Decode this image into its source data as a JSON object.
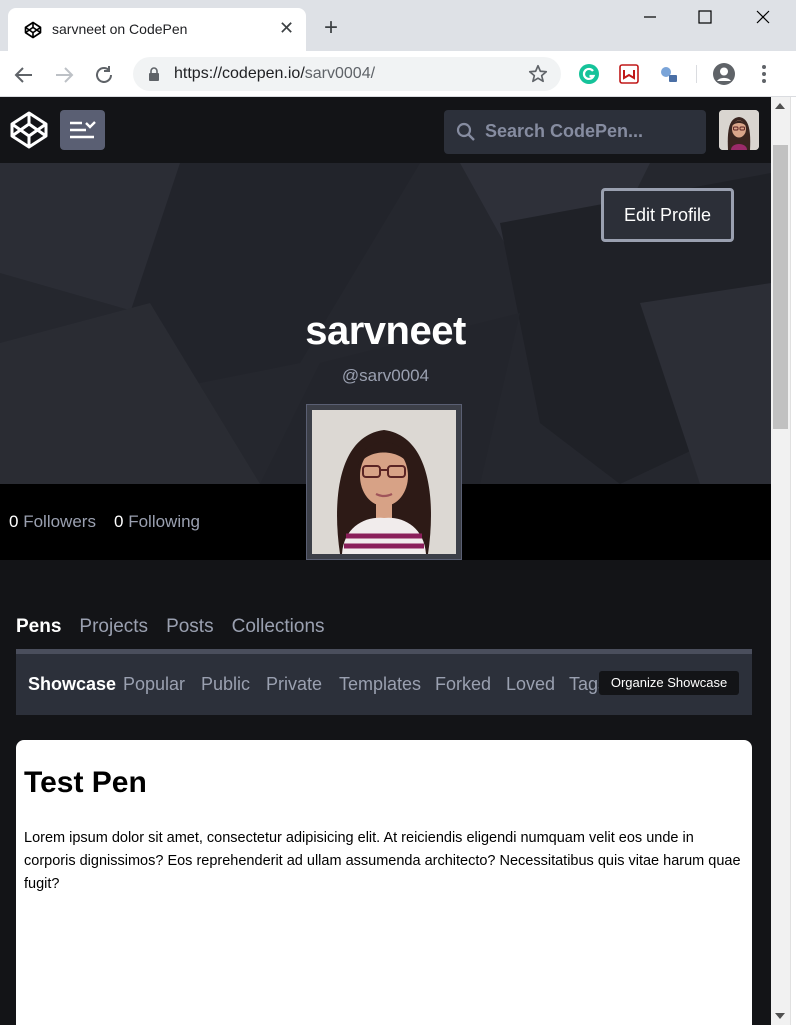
{
  "browser": {
    "tab_title": "sarvneet on CodePen",
    "url_host": "https://codepen.io/",
    "url_path": "sarv0004/"
  },
  "header": {
    "search_placeholder": "Search CodePen..."
  },
  "profile": {
    "edit_label": "Edit Profile",
    "name": "sarvneet",
    "handle": "@sarv0004",
    "followers_count": "0",
    "followers_label": "Followers",
    "following_count": "0",
    "following_label": "Following"
  },
  "tabs": {
    "main": [
      "Pens",
      "Projects",
      "Posts",
      "Collections"
    ],
    "sub": [
      "Showcase",
      "Popular",
      "Public",
      "Private",
      "Templates",
      "Forked",
      "Loved",
      "Tags"
    ],
    "organize_label": "Organize Showcase"
  },
  "pen": {
    "title": "Test Pen",
    "body": "Lorem ipsum dolor sit amet, consectetur adipisicing elit. At reiciendis eligendi numquam velit eos unde in corporis dignissimos? Eos reprehenderit ad ullam assumenda architecto? Necessitatibus quis vitae harum quae fugit?"
  },
  "colors": {
    "page_bg": "#131417",
    "hero_bg": "#25272e",
    "subnav_bg": "#2c303a",
    "muted_text": "#9aa0b0"
  }
}
